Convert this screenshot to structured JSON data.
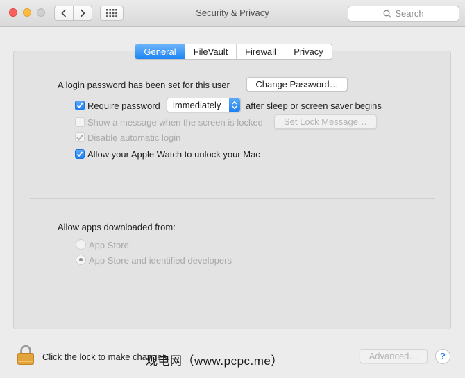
{
  "window": {
    "title": "Security & Privacy"
  },
  "toolbar": {
    "search_placeholder": "Search"
  },
  "tabs": [
    {
      "label": "General",
      "active": true
    },
    {
      "label": "FileVault",
      "active": false
    },
    {
      "label": "Firewall",
      "active": false
    },
    {
      "label": "Privacy",
      "active": false
    }
  ],
  "general": {
    "login_password_text": "A login password has been set for this user",
    "change_password_label": "Change Password…",
    "require_password": {
      "label": "Require password",
      "checked": true
    },
    "require_password_delay": "immediately",
    "require_password_suffix": "after sleep or screen saver begins",
    "show_message": {
      "label": "Show a message when the screen is locked",
      "checked": false,
      "enabled": false
    },
    "set_lock_message_label": "Set Lock Message…",
    "disable_auto_login": {
      "label": "Disable automatic login",
      "checked": true,
      "enabled": false
    },
    "apple_watch": {
      "label": "Allow your Apple Watch to unlock your Mac",
      "checked": true
    },
    "allow_apps_heading": "Allow apps downloaded from:",
    "allow_apps_options": [
      {
        "label": "App Store",
        "selected": false
      },
      {
        "label": "App Store and identified developers",
        "selected": true
      }
    ]
  },
  "footer": {
    "lock_text": "Click the lock to make changes.",
    "advanced_label": "Advanced…",
    "help_label": "?",
    "watermark": "观电网（www.pcpc.me）"
  },
  "colors": {
    "accent": "#1f7ff2",
    "close": "#fc605c",
    "minimize": "#fdbc40",
    "lock": "#e0a33a"
  }
}
